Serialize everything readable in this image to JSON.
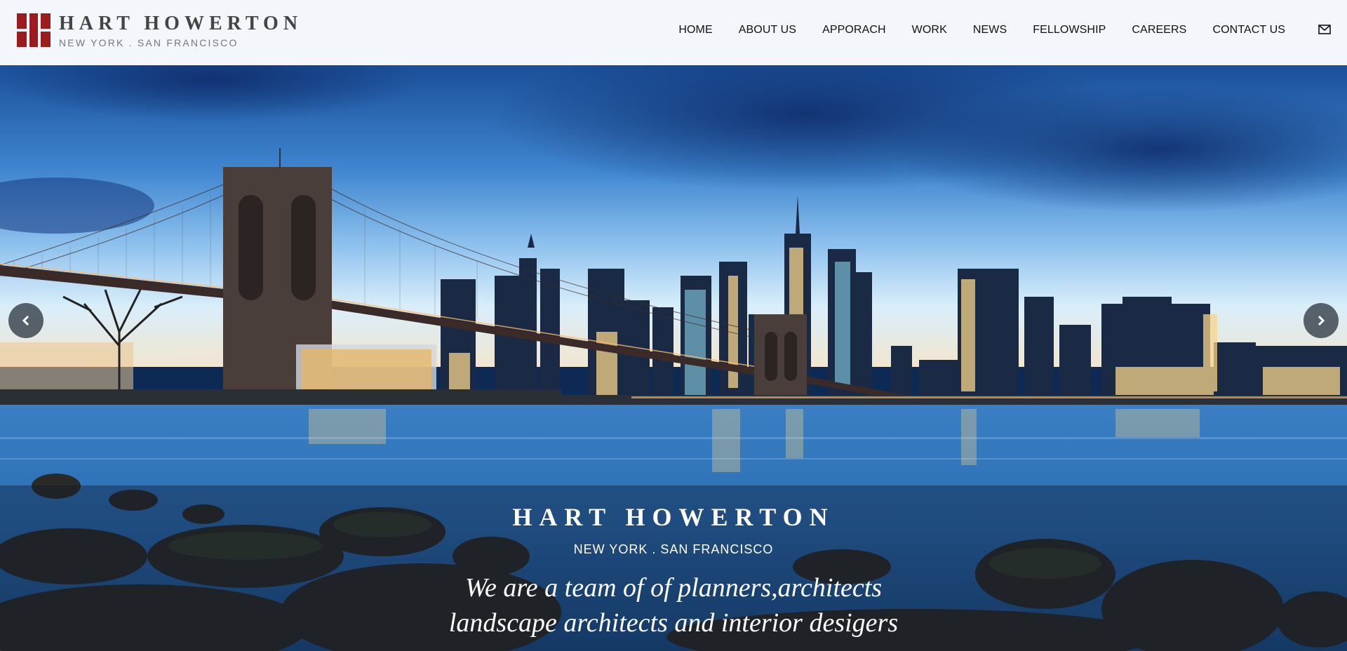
{
  "header": {
    "logo_name": "HART HOWERTON",
    "logo_sub": "NEW YORK . SAN FRANCISCO",
    "brand_color": "#9b1c1f",
    "nav": [
      "HOME",
      "ABOUT US",
      "APPORACH",
      "WORK",
      "NEWS",
      "FELLOWSHIP",
      "CAREERS",
      "CONTACT US"
    ],
    "mail_icon": "envelope-icon"
  },
  "hero": {
    "title": "HART HOWERTON",
    "subtitle": "NEW YORK . SAN FRANCISCO",
    "tagline_line1": "We are a team of of planners,architects",
    "tagline_line2": "landscape architects and interior desigers",
    "prev_icon": "chevron-left-icon",
    "next_icon": "chevron-right-icon"
  }
}
